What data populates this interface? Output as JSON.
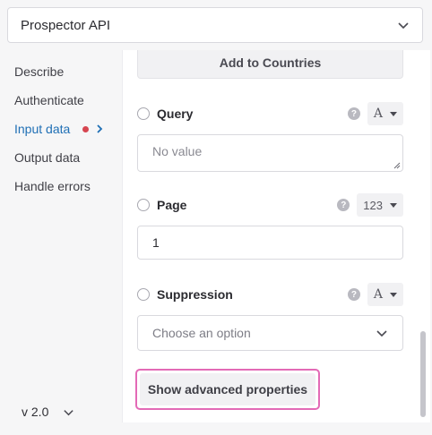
{
  "app_select": {
    "value": "Prospector API"
  },
  "sidebar": {
    "items": [
      {
        "label": "Describe"
      },
      {
        "label": "Authenticate"
      },
      {
        "label": "Input data"
      },
      {
        "label": "Output data"
      },
      {
        "label": "Handle errors"
      }
    ],
    "version": "v 2.0"
  },
  "main": {
    "add_button": "Add to Countries",
    "fields": {
      "query": {
        "label": "Query",
        "type_glyph": "A",
        "placeholder": "No value"
      },
      "page": {
        "label": "Page",
        "type_label": "123",
        "value": "1"
      },
      "suppression": {
        "label": "Suppression",
        "type_glyph": "A",
        "placeholder": "Choose an option"
      }
    },
    "help_glyph": "?",
    "advanced_button": "Show advanced properties"
  },
  "colors": {
    "accent": "#1f6fb5",
    "error_dot": "#d64550",
    "highlight_border": "#e36ab6"
  }
}
